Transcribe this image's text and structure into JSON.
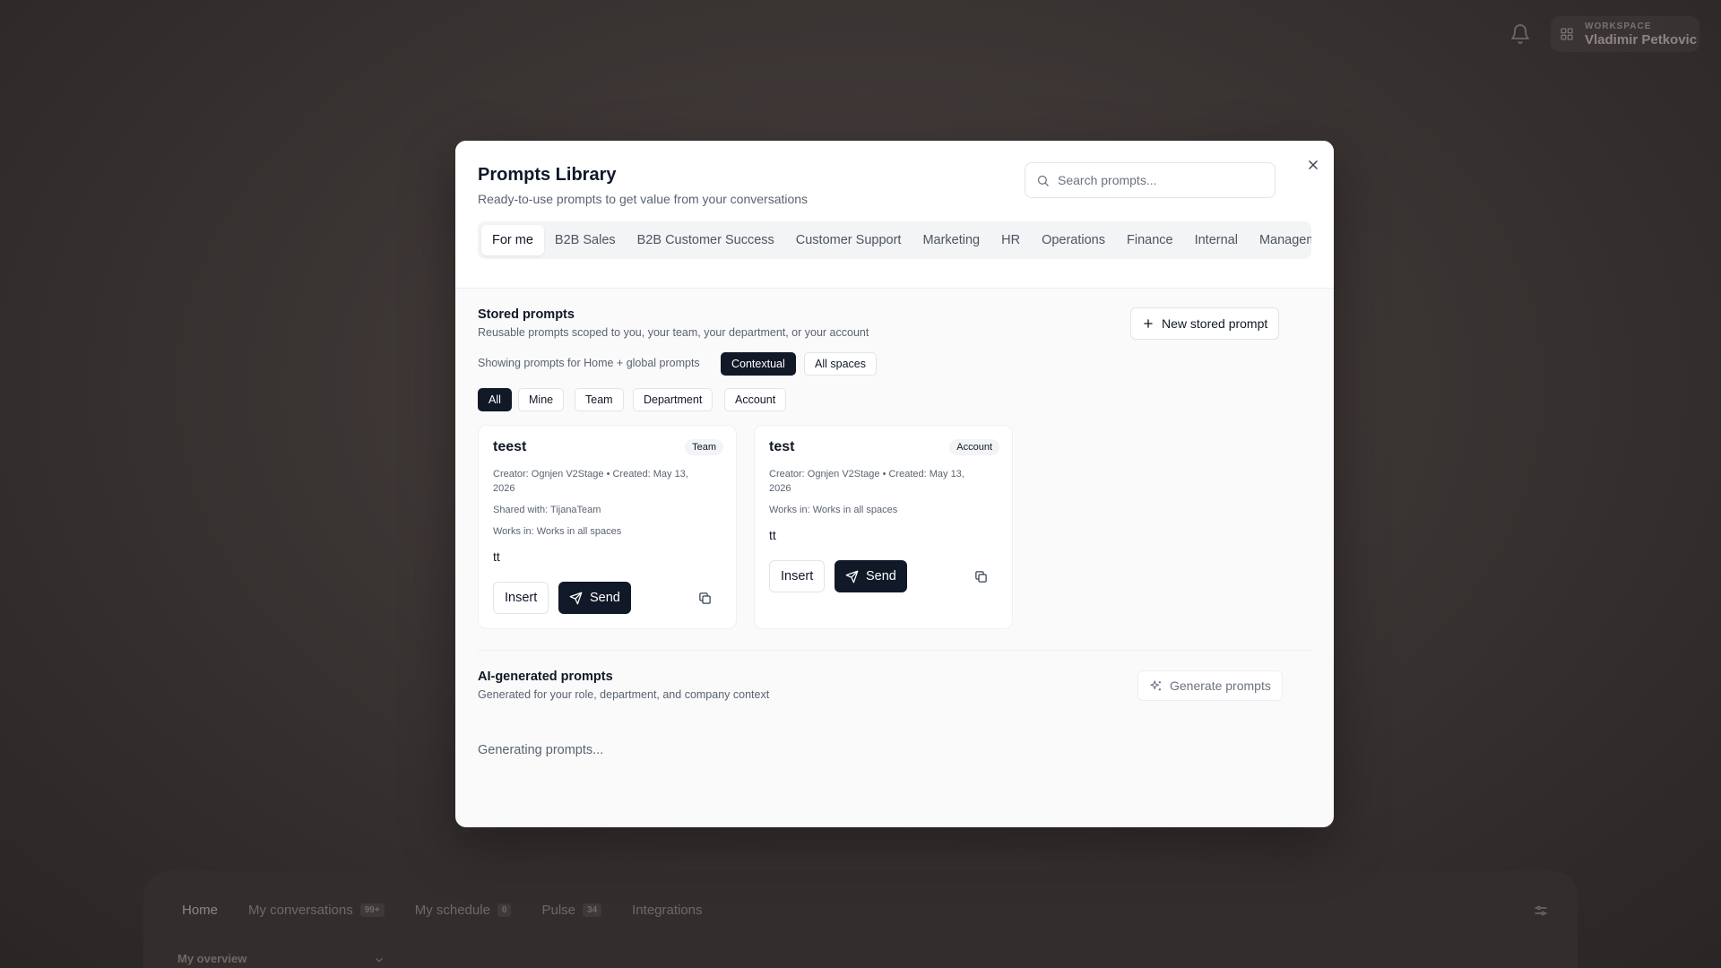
{
  "topbar": {
    "workspace_label": "WORKSPACE",
    "workspace_name": "Vladimir Petkovic"
  },
  "bottom": {
    "tabs": [
      {
        "label": "Home",
        "count": ""
      },
      {
        "label": "My conversations",
        "count": "99+"
      },
      {
        "label": "My schedule",
        "count": "0"
      },
      {
        "label": "Pulse",
        "count": "34"
      },
      {
        "label": "Integrations",
        "count": ""
      }
    ],
    "overview_label": "My overview"
  },
  "modal": {
    "title": "Prompts Library",
    "subtitle": "Ready-to-use prompts to get value from your conversations",
    "search_placeholder": "Search prompts...",
    "categories": [
      "For me",
      "B2B Sales",
      "B2B Customer Success",
      "Customer Support",
      "Marketing",
      "HR",
      "Operations",
      "Finance",
      "Internal",
      "Management"
    ],
    "active_category": "For me"
  },
  "stored": {
    "title": "Stored prompts",
    "subtitle": "Reusable prompts scoped to you, your team, your department, or your account",
    "new_button": "New stored prompt",
    "showing_text": "Showing prompts for Home + global prompts",
    "scope_pills": [
      "Contextual",
      "All spaces"
    ],
    "filter_pills": [
      "All",
      "Mine",
      "Team",
      "Department",
      "Account"
    ],
    "cards": [
      {
        "title": "teest",
        "badge": "Team",
        "creator_line": "Creator: Ognjen V2Stage  •  Created: May 13, 2026",
        "shared_line": "Shared with: TijanaTeam",
        "works_line": "Works in: Works in all spaces",
        "body": "tt",
        "insert_label": "Insert",
        "send_label": "Send"
      },
      {
        "title": "test",
        "badge": "Account",
        "creator_line": "Creator: Ognjen V2Stage  •  Created: May 13, 2026",
        "works_line": "Works in: Works in all spaces",
        "body": "tt",
        "insert_label": "Insert",
        "send_label": "Send"
      }
    ]
  },
  "ai": {
    "title": "AI-generated prompts",
    "subtitle": "Generated for your role, department, and company context",
    "generate_button": "Generate prompts",
    "status_text": "Generating prompts..."
  }
}
